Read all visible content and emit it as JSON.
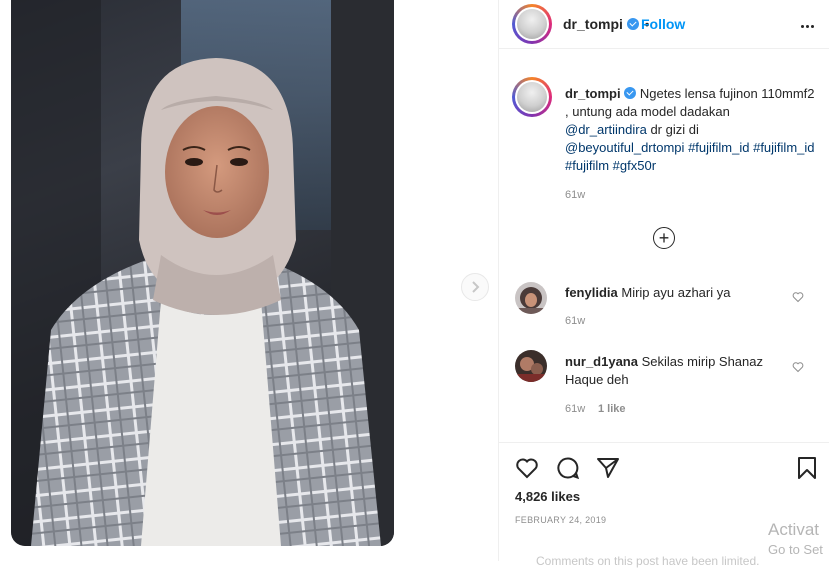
{
  "post": {
    "username": "dr_tompi",
    "follow_label": "Follow",
    "separator": "•"
  },
  "caption": {
    "username": "dr_tompi",
    "text_1": "Ngetes lensa fujinon 110mmf2 , untung ada model dadakan ",
    "mention_1": "@dr_artiindira",
    "text_2": " dr gizi di ",
    "mention_2": "@beyoutiful_drtompi",
    "hashtags": "#fujifilm_id #fujifilm_id #fujifilm #gfx50r",
    "age": "61w"
  },
  "comments": [
    {
      "username": "fenylidia",
      "text": "Mirip ayu azhari ya",
      "age": "61w",
      "likes": ""
    },
    {
      "username": "nur_d1yana",
      "text": "Sekilas mirip Shanaz Haque deh",
      "age": "61w",
      "likes": "1 like"
    }
  ],
  "actions": {
    "likes": "4,826 likes",
    "date": "FEBRUARY 24, 2019",
    "comments_disabled": "Comments on this post have been limited."
  },
  "overlay": {
    "activate_line1": "Activat",
    "activate_line2": "Go to Set"
  },
  "icons": {
    "like": "heart-icon",
    "comment": "comment-icon",
    "share": "paper-plane-icon",
    "save": "bookmark-icon",
    "more": "ellipsis-icon",
    "next": "chevron-right-icon",
    "load_more": "plus-circle-icon"
  },
  "colors": {
    "link": "#00376b",
    "follow": "#0095f6",
    "verified": "#3897f0",
    "muted": "#8e8e8e"
  }
}
